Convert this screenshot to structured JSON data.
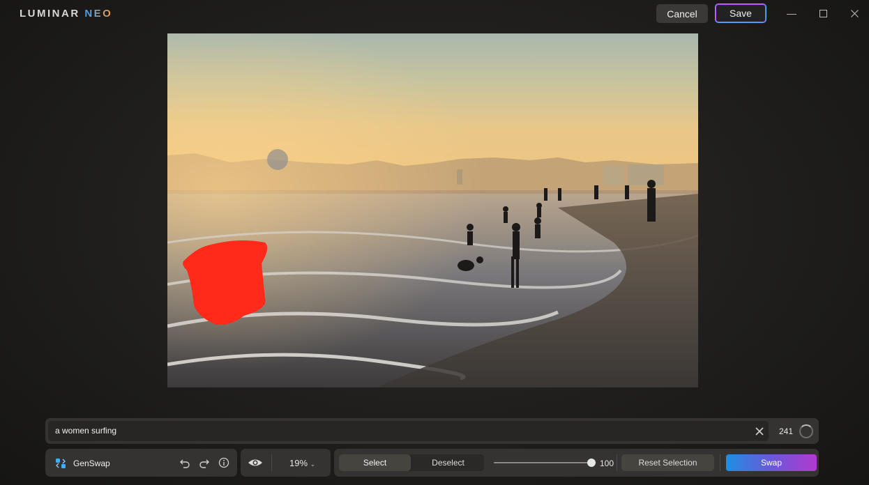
{
  "app": {
    "logo_primary": "LUMINAR",
    "logo_secondary": "NEO",
    "cancel_label": "Cancel",
    "save_label": "Save",
    "window_controls": [
      "minimize-icon",
      "maximize-icon",
      "close-icon"
    ]
  },
  "canvas": {
    "image_description_icon": "beach-photo",
    "mask_color": "#ff2a1a"
  },
  "prompt": {
    "value": "a women surfing",
    "char_count": "241",
    "clear_icon": "close-icon",
    "status_icon": "spinner-icon"
  },
  "toolbar": {
    "tool_label": "GenSwap",
    "tool_icon": "genswap-icon",
    "undo_icon": "undo-icon",
    "redo_icon": "redo-icon",
    "info_icon": "info-icon",
    "eye_icon": "eye-icon",
    "zoom": "19%",
    "select_label": "Select",
    "deselect_label": "Deselect",
    "brush_size": "100",
    "reset_label": "Reset Selection",
    "swap_label": "Swap"
  },
  "colors": {
    "accent_blue": "#1f8fe3",
    "accent_purple": "#b13ad0",
    "panel": "#343331"
  }
}
